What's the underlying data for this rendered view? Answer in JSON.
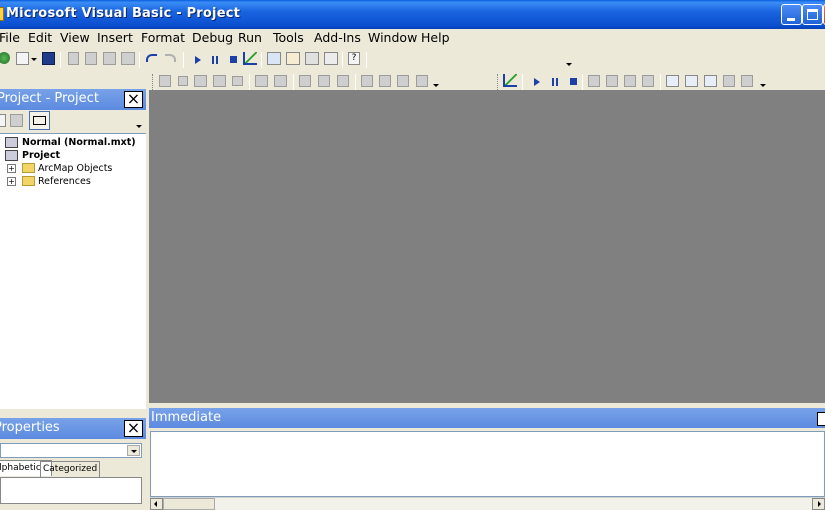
{
  "window": {
    "title": "Microsoft Visual Basic - Project"
  },
  "menu": [
    "File",
    "Edit",
    "View",
    "Insert",
    "Format",
    "Debug",
    "Run",
    "Tools",
    "Add-Ins",
    "Window",
    "Help"
  ],
  "project_panel": {
    "title": "Project - Project",
    "tree": [
      {
        "label": "Normal (Normal.mxt)",
        "bold": true
      },
      {
        "label": "Project",
        "bold": true
      },
      {
        "label": "ArcMap Objects",
        "bold": false
      },
      {
        "label": "References",
        "bold": false
      }
    ]
  },
  "properties_panel": {
    "title": "Properties",
    "tabs": [
      "Alphabetic",
      "Categorized"
    ]
  },
  "immediate_panel": {
    "title": "Immediate"
  },
  "colors": {
    "titlebar": "#0b4fcf",
    "panel_title": "#6a93e4",
    "workspace": "#808080",
    "chrome": "#ece9d8"
  }
}
